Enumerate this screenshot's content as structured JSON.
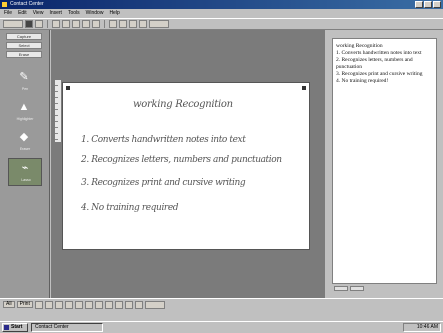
{
  "window": {
    "title": "Contact Center"
  },
  "menu": [
    "File",
    "Edit",
    "View",
    "Insert",
    "Tools",
    "Window",
    "Help"
  ],
  "side_buttons": [
    "Capture",
    "Select",
    "Erase"
  ],
  "tools": [
    {
      "icon": "pen-icon",
      "label": "Pen"
    },
    {
      "icon": "highlighter-icon",
      "label": "Highlighter"
    },
    {
      "icon": "eraser-icon",
      "label": "Eraser"
    },
    {
      "icon": "lasso-icon",
      "label": "Lasso"
    }
  ],
  "note": {
    "title": "working Recognition",
    "lines": [
      "1. Converts handwritten notes into text",
      "2. Recognizes letters, numbers and punctuation",
      "3. Recognizes print and cursive writing",
      "4. No training required"
    ]
  },
  "recognized_text": {
    "title": "working Recognition",
    "lines": [
      "1. Converts handwritten notes into text",
      "2. Recognizes letters, numbers and punctuation",
      "3. Recognizes print and cursive writing",
      "4. No training required!"
    ]
  },
  "bottom_bar": [
    "All",
    "Print"
  ],
  "taskbar": {
    "start": "Start",
    "task": "Contact Center",
    "clock": "10:46 AM"
  }
}
